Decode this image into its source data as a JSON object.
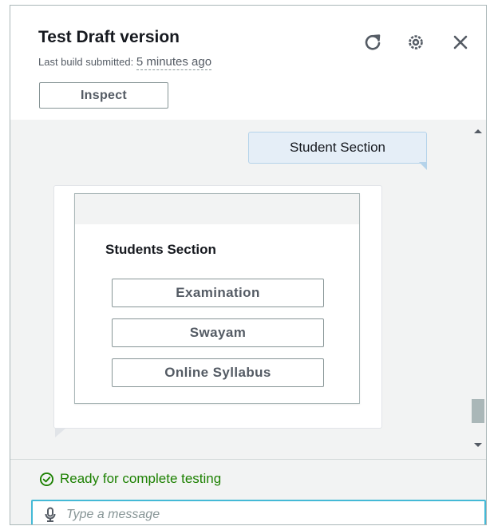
{
  "header": {
    "title": "Test Draft version",
    "subtitle_prefix": "Last build submitted:",
    "subtitle_time": "5 minutes ago",
    "inspect_label": "Inspect",
    "icons": [
      "refresh-icon",
      "settings-icon",
      "close-icon"
    ]
  },
  "chat": {
    "user_message": "Student Section",
    "card": {
      "title": "Students Section",
      "buttons": [
        "Examination",
        "Swayam",
        "Online Syllabus"
      ]
    }
  },
  "footer": {
    "status": "Ready for complete testing",
    "input_placeholder": "Type a message",
    "input_value": ""
  },
  "colors": {
    "status_green": "#1d8102",
    "input_focus": "#44b9d6",
    "user_bubble": "#e5eef7",
    "chat_bg": "#f2f3f3"
  }
}
